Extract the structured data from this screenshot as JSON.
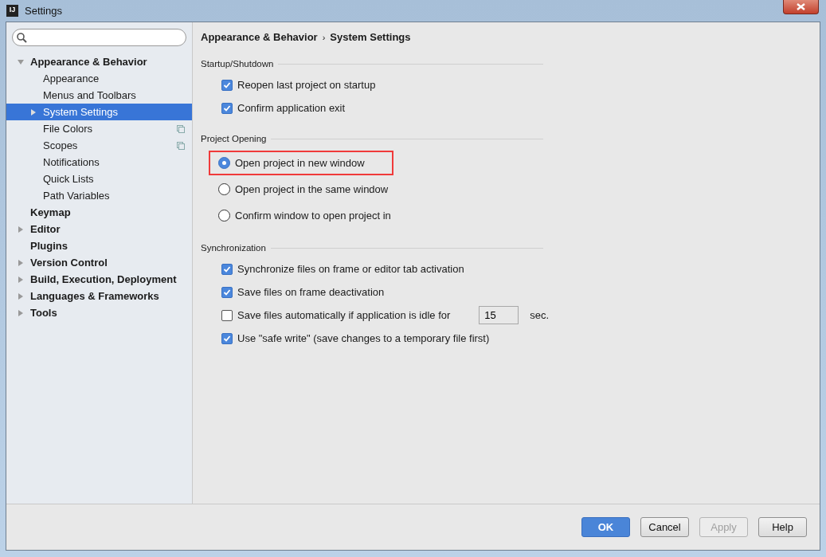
{
  "window": {
    "title": "Settings",
    "app_icon_text": "IJ"
  },
  "tree": [
    {
      "label": "Appearance & Behavior",
      "expanded": true,
      "selected": false,
      "children": [
        {
          "label": "Appearance",
          "selected": false,
          "copy_icon": false
        },
        {
          "label": "Menus and Toolbars",
          "selected": false,
          "copy_icon": false
        },
        {
          "label": "System Settings",
          "expanded": false,
          "selected": true,
          "copy_icon": false
        },
        {
          "label": "File Colors",
          "selected": false,
          "copy_icon": true
        },
        {
          "label": "Scopes",
          "selected": false,
          "copy_icon": true
        },
        {
          "label": "Notifications",
          "selected": false,
          "copy_icon": false
        },
        {
          "label": "Quick Lists",
          "selected": false,
          "copy_icon": false
        },
        {
          "label": "Path Variables",
          "selected": false,
          "copy_icon": false
        }
      ]
    },
    {
      "label": "Keymap",
      "selected": false
    },
    {
      "label": "Editor",
      "expanded": false,
      "selected": false
    },
    {
      "label": "Plugins",
      "selected": false
    },
    {
      "label": "Version Control",
      "expanded": false,
      "selected": false
    },
    {
      "label": "Build, Execution, Deployment",
      "expanded": false,
      "selected": false
    },
    {
      "label": "Languages & Frameworks",
      "expanded": false,
      "selected": false
    },
    {
      "label": "Tools",
      "expanded": false,
      "selected": false
    }
  ],
  "breadcrumb": [
    "Appearance & Behavior",
    "System Settings"
  ],
  "breadcrumb_separator": "›",
  "sections": [
    {
      "title": "Startup/Shutdown",
      "options": [
        {
          "kind": "checkbox",
          "label": "Reopen last project on startup",
          "checked": true
        },
        {
          "kind": "checkbox",
          "label": "Confirm application exit",
          "checked": true
        }
      ]
    },
    {
      "title": "Project Opening",
      "options": [
        {
          "kind": "radio",
          "label": "Open project in new window",
          "selected": true,
          "highlighted": true
        },
        {
          "kind": "radio",
          "label": "Open project in the same window",
          "selected": false,
          "highlighted": false
        },
        {
          "kind": "radio",
          "label": "Confirm window to open project in",
          "selected": false,
          "highlighted": false
        }
      ]
    },
    {
      "title": "Synchronization",
      "options": [
        {
          "kind": "checkbox",
          "label": "Synchronize files on frame or editor tab activation",
          "checked": true
        },
        {
          "kind": "checkbox",
          "label": "Save files on frame deactivation",
          "checked": true
        },
        {
          "kind": "checkbox_field",
          "label": "Save files automatically if application is idle for",
          "checked": false,
          "value": "15",
          "unit": "sec."
        },
        {
          "kind": "checkbox",
          "label": "Use \"safe write\" (save changes to a temporary file first)",
          "checked": true
        }
      ]
    }
  ],
  "buttons": [
    {
      "label": "OK",
      "kind": "primary",
      "disabled": false
    },
    {
      "label": "Cancel",
      "kind": "normal",
      "disabled": false
    },
    {
      "label": "Apply",
      "kind": "normal",
      "disabled": true
    },
    {
      "label": "Help",
      "kind": "normal",
      "disabled": false
    }
  ]
}
